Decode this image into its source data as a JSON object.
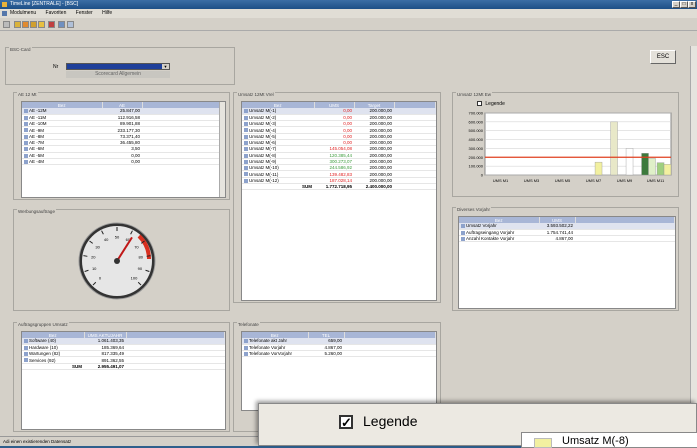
{
  "window": {
    "title": "TimeLine [ZENTRALE] - [BSC]",
    "min": "_",
    "max": "□",
    "close": "x"
  },
  "menu": [
    "Modulmenu",
    "Favoriten",
    "Fenster",
    "Hilfe"
  ],
  "bsc_card": {
    "title": "BSC-Card",
    "field_label": "Nr",
    "field_value": "",
    "field_sub": "Scorecard Allgemein",
    "esc_label": "ESC"
  },
  "ae_panel": {
    "title": "AE 12 Mt",
    "headers": [
      "Bez",
      "AE"
    ],
    "rows": [
      [
        "AE -12M",
        "25.847,00"
      ],
      [
        "AE -11M",
        "112.916,58"
      ],
      [
        "AE -10M",
        "89.901,88"
      ],
      [
        "AE -9M",
        "233.177,30"
      ],
      [
        "AE -8M",
        "73.371,40"
      ],
      [
        "AE -7M",
        "36.455,80"
      ],
      [
        "AE -6M",
        "3,50"
      ],
      [
        "AE -5M",
        "0,00"
      ],
      [
        "AE -4M",
        "0,00"
      ]
    ]
  },
  "gauge_panel": {
    "title": "Werbungsauftrage",
    "ticks": [
      "0",
      "10",
      "20",
      "30",
      "40",
      "50",
      "60",
      "70",
      "80",
      "90",
      "100"
    ],
    "value_pct": 62
  },
  "umsatz_panel": {
    "title": "Umsatz 12Mt Vrel",
    "headers": [
      "Bez",
      "UMS",
      "Target"
    ],
    "rows": [
      [
        "Umsatz M(-1)",
        "0,00",
        "200.000,00",
        "red"
      ],
      [
        "Umsatz M(-2)",
        "0,00",
        "200.000,00",
        "red"
      ],
      [
        "Umsatz M(-3)",
        "0,00",
        "200.000,00",
        "red"
      ],
      [
        "Umsatz M(-4)",
        "0,00",
        "200.000,00",
        "red"
      ],
      [
        "Umsatz M(-5)",
        "0,00",
        "200.000,00",
        "red"
      ],
      [
        "Umsatz M(-6)",
        "0,00",
        "200.000,00",
        "red"
      ],
      [
        "Umsatz M(-7)",
        "145.054,08",
        "200.000,00",
        "red"
      ],
      [
        "Umsatz M(-8)",
        "120.385,44",
        "200.000,00",
        "grn"
      ],
      [
        "Umsatz M(-9)",
        "300.273,07",
        "200.000,00",
        "grn"
      ],
      [
        "Umsatz M(-10)",
        "244.586,92",
        "200.000,00",
        "grn"
      ],
      [
        "Umsatz M(-11)",
        "139.482,83",
        "200.000,00",
        "red"
      ],
      [
        "Umsatz M(-12)",
        "187.028,14",
        "200.000,00",
        "red"
      ]
    ],
    "sum_label": "SUM",
    "sum_ums": "1.772.718,95",
    "sum_target": "2.400.000,00"
  },
  "chart_panel": {
    "title": "Umsatz 12Mt Ew",
    "legend_label": "Legende"
  },
  "chart_data": {
    "type": "bar",
    "categories": [
      "UMS M1",
      "UMS M2",
      "UMS M3",
      "UMS M4",
      "UMS M5",
      "UMS M6",
      "UMS M7",
      "UMS M8",
      "UMS M9",
      "UMS M10",
      "UMS M11",
      "UMS M12"
    ],
    "x_tick_labels": [
      "UMS M1",
      "UMS M3",
      "UMS M5",
      "UMS M7",
      "UMS M9",
      "UMS M11"
    ],
    "y_tick_labels": [
      "700.000",
      "600.000",
      "500.000",
      "400.000",
      "300.000",
      "200.000",
      "100.000",
      "0"
    ],
    "ylim": [
      0,
      700000
    ],
    "target": 200000,
    "series": [
      {
        "values": [
          0,
          0,
          0,
          0,
          0,
          0,
          0,
          145054,
          600000,
          300273,
          244587,
          139483
        ]
      },
      {
        "values": [
          0,
          0,
          0,
          0,
          0,
          0,
          0,
          0,
          0,
          0,
          187028,
          120385
        ]
      }
    ],
    "bar_colors": [
      "#f2f0a0",
      "#e8e8c8",
      "#ffffff",
      "#3c7a3c",
      "#9fcf7f",
      "#dff0c8"
    ],
    "target_color": "#e04020"
  },
  "diverses_panel": {
    "title": "Diverses Vorjahr",
    "headers": [
      "Bez",
      "UMS"
    ],
    "rows": [
      [
        "Umsatz Vorjahr",
        "3.593.502,22"
      ],
      [
        "Auftragseingang Vorjahr",
        "1.754.741,44"
      ],
      [
        "Anzahl Kontakte Vorjahr",
        "4.867,00"
      ]
    ]
  },
  "auftrag_panel": {
    "title": "Auftragsgruppen Umsatz",
    "headers": [
      "Bez",
      "UMS AKTUJAHR"
    ],
    "rows": [
      [
        "Software (40)",
        "1.061.403,35"
      ],
      [
        "Hardware (10)",
        "185.369,64"
      ],
      [
        "Wartungen (82)",
        "817.335,49"
      ],
      [
        "Services (92)",
        "891.362,55"
      ]
    ],
    "sum_label": "SUM",
    "sum_value": "2.955.491,07"
  },
  "telefon_panel": {
    "title": "Telefonate",
    "headers": [
      "Bez",
      "TEL"
    ],
    "rows": [
      [
        "Telefonate akt Jahr",
        "659,00"
      ],
      [
        "Telefonate Vorjahr",
        "4.867,00"
      ],
      [
        "Telefonate VorVorjahr",
        "5.260,00"
      ]
    ]
  },
  "statusbar": "Adi einen existierenden Datensatz",
  "zoom": {
    "legend_label": "Legende",
    "partial_label": "Umsatz M(-8)"
  }
}
